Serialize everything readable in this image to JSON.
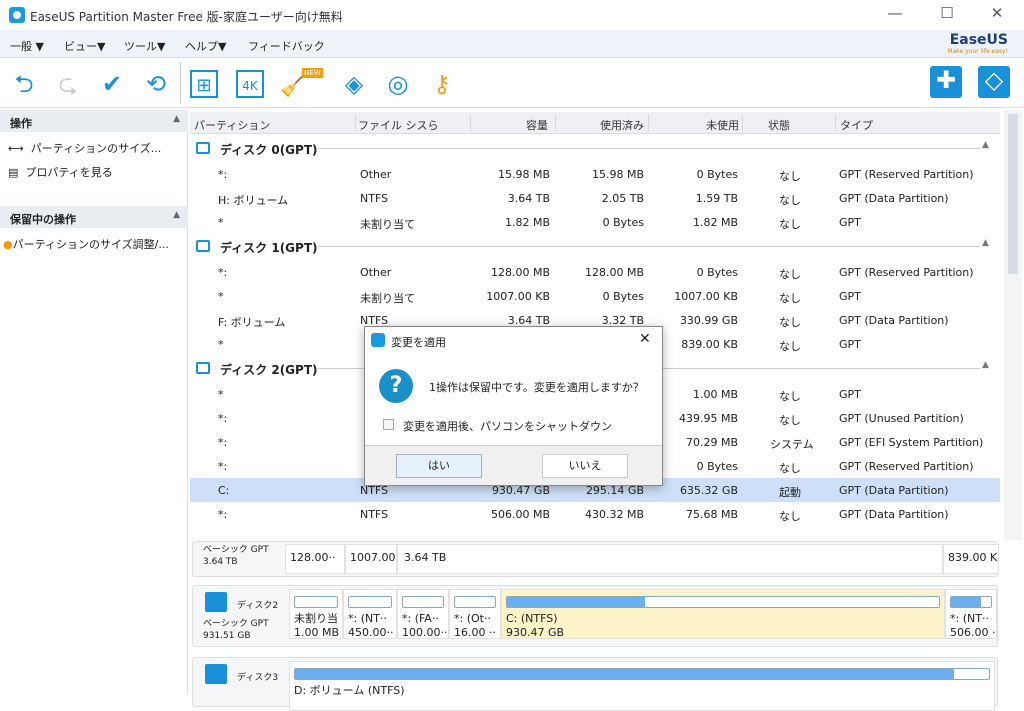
{
  "window": {
    "title": "EaseUS Partition Master Free 版-家庭ユーザー向け無料",
    "minimize": "—",
    "maximize": "☐",
    "close": "✕"
  },
  "menu": [
    "一般 ▼",
    "ビュー▼",
    "ツール▼",
    "ヘルプ▼",
    "フィードバック"
  ],
  "brand": {
    "name": "EaseUS",
    "tagline": "Make your life easy!",
    "accent": "#1a90d8"
  },
  "toolbar": {
    "icons": [
      "undo-icon",
      "redo-icon",
      "apply-check-icon",
      "refresh-icon",
      "migrate-os-icon",
      "4k-align-icon",
      "cleanup-icon",
      "wipe-icon",
      "disk-icon",
      "key-icon"
    ],
    "new_badge": "NEW"
  },
  "left": {
    "ops_title": "操作",
    "ops": [
      "パーティションのサイズ...",
      "プロパティを見る"
    ],
    "pending_title": "保留中の操作",
    "pending": [
      "パーティションのサイズ調整/..."
    ]
  },
  "table": {
    "headers": [
      "パーティション",
      "ファイル シスら",
      "容量",
      "使用済み",
      "未使用",
      "状態",
      "タイプ"
    ],
    "disks": [
      {
        "name": "ディスク 0(GPT)",
        "rows": [
          [
            "*:",
            "Other",
            "15.98 MB",
            "15.98 MB",
            "0 Bytes",
            "なし",
            "GPT (Reserved Partition)"
          ],
          [
            "H: ボリューム",
            "NTFS",
            "3.64 TB",
            "2.05 TB",
            "1.59 TB",
            "なし",
            "GPT (Data Partition)"
          ],
          [
            "*",
            "未割り当て",
            "1.82 MB",
            "0 Bytes",
            "1.82 MB",
            "なし",
            "GPT"
          ]
        ]
      },
      {
        "name": "ディスク 1(GPT)",
        "rows": [
          [
            "*:",
            "Other",
            "128.00 MB",
            "128.00 MB",
            "0 Bytes",
            "なし",
            "GPT (Reserved Partition)"
          ],
          [
            "*",
            "未割り当て",
            "1007.00 KB",
            "0 Bytes",
            "1007.00 KB",
            "なし",
            "GPT"
          ],
          [
            "F: ボリューム",
            "NTFS",
            "3.64 TB",
            "3.32 TB",
            "330.99 GB",
            "なし",
            "GPT (Data Partition)"
          ],
          [
            "*",
            "",
            "",
            "",
            "839.00 KB",
            "なし",
            "GPT"
          ]
        ]
      },
      {
        "name": "ディスク 2(GPT)",
        "rows": [
          [
            "*",
            "",
            "",
            "",
            "1.00 MB",
            "なし",
            "GPT"
          ],
          [
            "*:",
            "",
            "",
            "",
            "439.95 MB",
            "なし",
            "GPT (Unused Partition)"
          ],
          [
            "*:",
            "",
            "",
            "",
            "70.29 MB",
            "システム",
            "GPT (EFI System Partition)"
          ],
          [
            "*:",
            "",
            "",
            "",
            "0 Bytes",
            "なし",
            "GPT (Reserved Partition)"
          ],
          [
            "C:",
            "NTFS",
            "930.47 GB",
            "295.14 GB",
            "635.32 GB",
            "起動",
            "GPT (Data Partition)"
          ],
          [
            "*:",
            "NTFS",
            "506.00 MB",
            "430.32 MB",
            "75.68 MB",
            "なし",
            "GPT (Data Partition)"
          ]
        ]
      }
    ],
    "selected": "C:"
  },
  "lower": {
    "disk1": {
      "type": "ベーシック GPT",
      "size": "3.64 TB",
      "parts": [
        "128.00··",
        "1007.00··",
        "3.64 TB",
        "839.00 KE"
      ]
    },
    "disk2": {
      "name": "ディスク2",
      "type": "ベーシック GPT",
      "size": "931.51 GB",
      "parts": [
        {
          "l": "未割り当",
          "s": "1.00 MB",
          "used": 0
        },
        {
          "l": "*: (NT··",
          "s": "450.00··",
          "used": 0
        },
        {
          "l": "*: (FA··",
          "s": "100.00··",
          "used": 0
        },
        {
          "l": "*: (Ot··",
          "s": "16.00 ··",
          "used": 0
        },
        {
          "l": "C: (NTFS)",
          "s": "930.47 GB",
          "used": 32
        },
        {
          "l": "*: (NT··",
          "s": "506.00 ··",
          "used": 75
        }
      ]
    },
    "disk3": {
      "name": "ディスク3",
      "part": "D: ボリューム (NTFS)",
      "used": 95
    }
  },
  "dialog": {
    "title": "変更を適用",
    "message": "1操作は保留中です。変更を適用しますか？",
    "checkbox": "変更を適用後、パソコンをシャットダウン",
    "checked": false,
    "yes": "はい",
    "no": "いいえ"
  }
}
